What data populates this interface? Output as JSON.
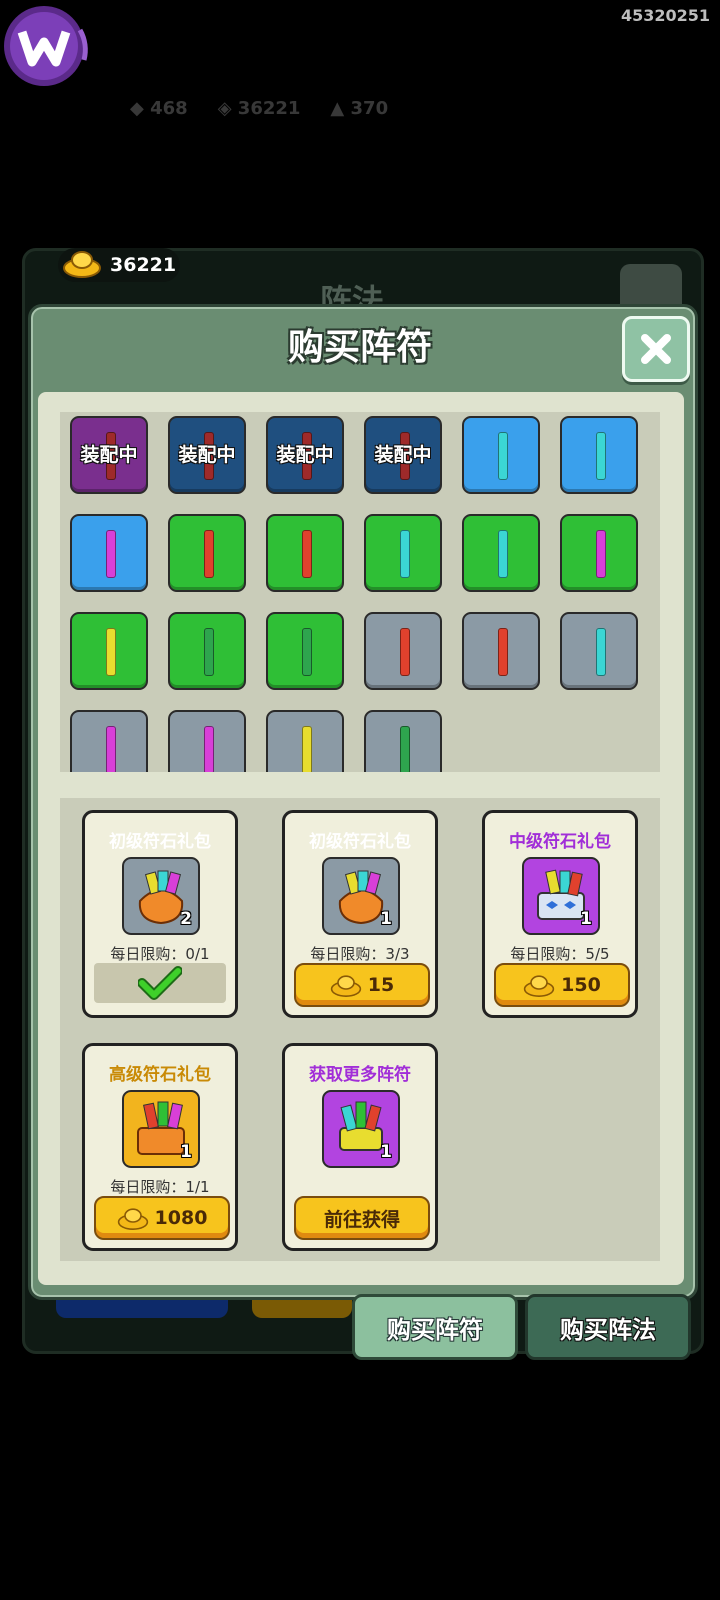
{
  "status": {
    "user_id": "45320251"
  },
  "background": {
    "gold_amount": "36221",
    "panel_title": "阵法"
  },
  "modal": {
    "title": "购买阵符",
    "equipped_label": "装配中",
    "slots": [
      {
        "color": "#7a2f8e",
        "bar": "#9e2a2a",
        "equipped": true
      },
      {
        "color": "#1f4f7f",
        "bar": "#9e2a2a",
        "equipped": true
      },
      {
        "color": "#1f4f7f",
        "bar": "#9e2a2a",
        "equipped": true
      },
      {
        "color": "#1f4f7f",
        "bar": "#9e2a2a",
        "equipped": true
      },
      {
        "color": "#3aa0ec",
        "bar": "#3bd6d4",
        "equipped": false
      },
      {
        "color": "#3aa0ec",
        "bar": "#3bd6d4",
        "equipped": false
      },
      {
        "color": "#3aa0ec",
        "bar": "#d83fd8",
        "equipped": false
      },
      {
        "color": "#2fbf36",
        "bar": "#e0412d",
        "equipped": false
      },
      {
        "color": "#2fbf36",
        "bar": "#e0412d",
        "equipped": false
      },
      {
        "color": "#2fbf36",
        "bar": "#3bd6d4",
        "equipped": false
      },
      {
        "color": "#2fbf36",
        "bar": "#3bd6d4",
        "equipped": false
      },
      {
        "color": "#2fbf36",
        "bar": "#d83fd8",
        "equipped": false
      },
      {
        "color": "#2fbf36",
        "bar": "#e8dd2f",
        "equipped": false
      },
      {
        "color": "#2fbf36",
        "bar": "#2ea54e",
        "equipped": false
      },
      {
        "color": "#2fbf36",
        "bar": "#2ea54e",
        "equipped": false
      },
      {
        "color": "#8b9aa5",
        "bar": "#e0412d",
        "equipped": false
      },
      {
        "color": "#8b9aa5",
        "bar": "#e0412d",
        "equipped": false
      },
      {
        "color": "#8b9aa5",
        "bar": "#3bd6d4",
        "equipped": false
      },
      {
        "color": "#8b9aa5",
        "bar": "#d83fd8",
        "equipped": false
      },
      {
        "color": "#8b9aa5",
        "bar": "#d83fd8",
        "equipped": false
      },
      {
        "color": "#8b9aa5",
        "bar": "#e8dd2f",
        "equipped": false
      },
      {
        "color": "#8b9aa5",
        "bar": "#2ea54e",
        "equipped": false
      }
    ]
  },
  "shop": {
    "cards": [
      {
        "title": "初级符石礼包",
        "title_color": "#333333",
        "icon_bg": "#8b9aa5",
        "count": "2",
        "limit": "每日限购：0/1",
        "button": "",
        "purchased": true
      },
      {
        "title": "初级符石礼包",
        "title_color": "#333333",
        "icon_bg": "#8b9aa5",
        "count": "1",
        "limit": "每日限购：3/3",
        "button": "15",
        "purchased": false
      },
      {
        "title": "中级符石礼包",
        "title_color": "#a12ed8",
        "icon_bg": "#b244e0",
        "count": "1",
        "limit": "每日限购：5/5",
        "button": "150",
        "purchased": false
      },
      {
        "title": "高级符石礼包",
        "title_color": "#c98a06",
        "icon_bg": "#f2b41e",
        "count": "1",
        "limit": "每日限购：1/1",
        "button": "1080",
        "purchased": false
      },
      {
        "title": "获取更多阵符",
        "title_color": "#a12ed8",
        "icon_bg": "#b244e0",
        "count": "1",
        "limit": "",
        "button": "前往获得",
        "purchased": false
      }
    ]
  },
  "tabs": {
    "buy_fu": "购买阵符",
    "buy_fa": "购买阵法"
  }
}
